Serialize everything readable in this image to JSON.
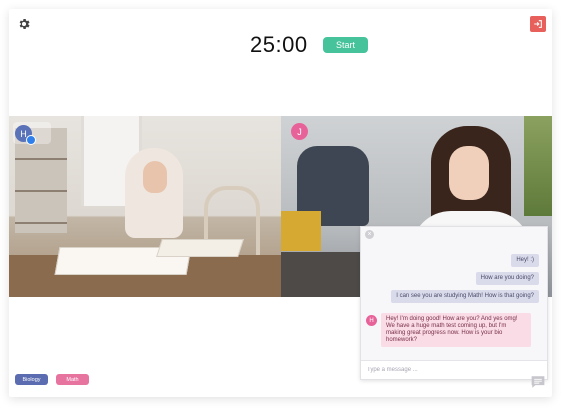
{
  "header": {
    "timer": "25:00",
    "start_label": "Start"
  },
  "participants": {
    "left": {
      "initial": "H"
    },
    "right": {
      "initial": "J"
    }
  },
  "chat": {
    "messages": [
      {
        "direction": "out",
        "text": "Hey! :)"
      },
      {
        "direction": "out",
        "text": "How are you doing?"
      },
      {
        "direction": "out",
        "text": "I can see you are studying Math! How is that going?"
      },
      {
        "direction": "in",
        "text": "Hey! I'm doing good! How are you? And yes omg! We have a huge math test coming up, but I'm making great progress now. How is your bio homework?"
      }
    ],
    "avatar_initial": "H",
    "input_placeholder": "Type a message ..."
  },
  "subjects": [
    {
      "label": "Biology",
      "color": "#5c6cb0"
    },
    {
      "label": "Math",
      "color": "#e7739f"
    }
  ],
  "colors": {
    "start": "#46c39a",
    "exit": "#e8605b",
    "avatar_h": "#5a72b8",
    "avatar_j": "#e8629a"
  },
  "icons": {
    "settings": "gear-icon",
    "exit": "exit-icon",
    "chat_toggle": "chat-bubble-icon",
    "close": "close-icon"
  }
}
